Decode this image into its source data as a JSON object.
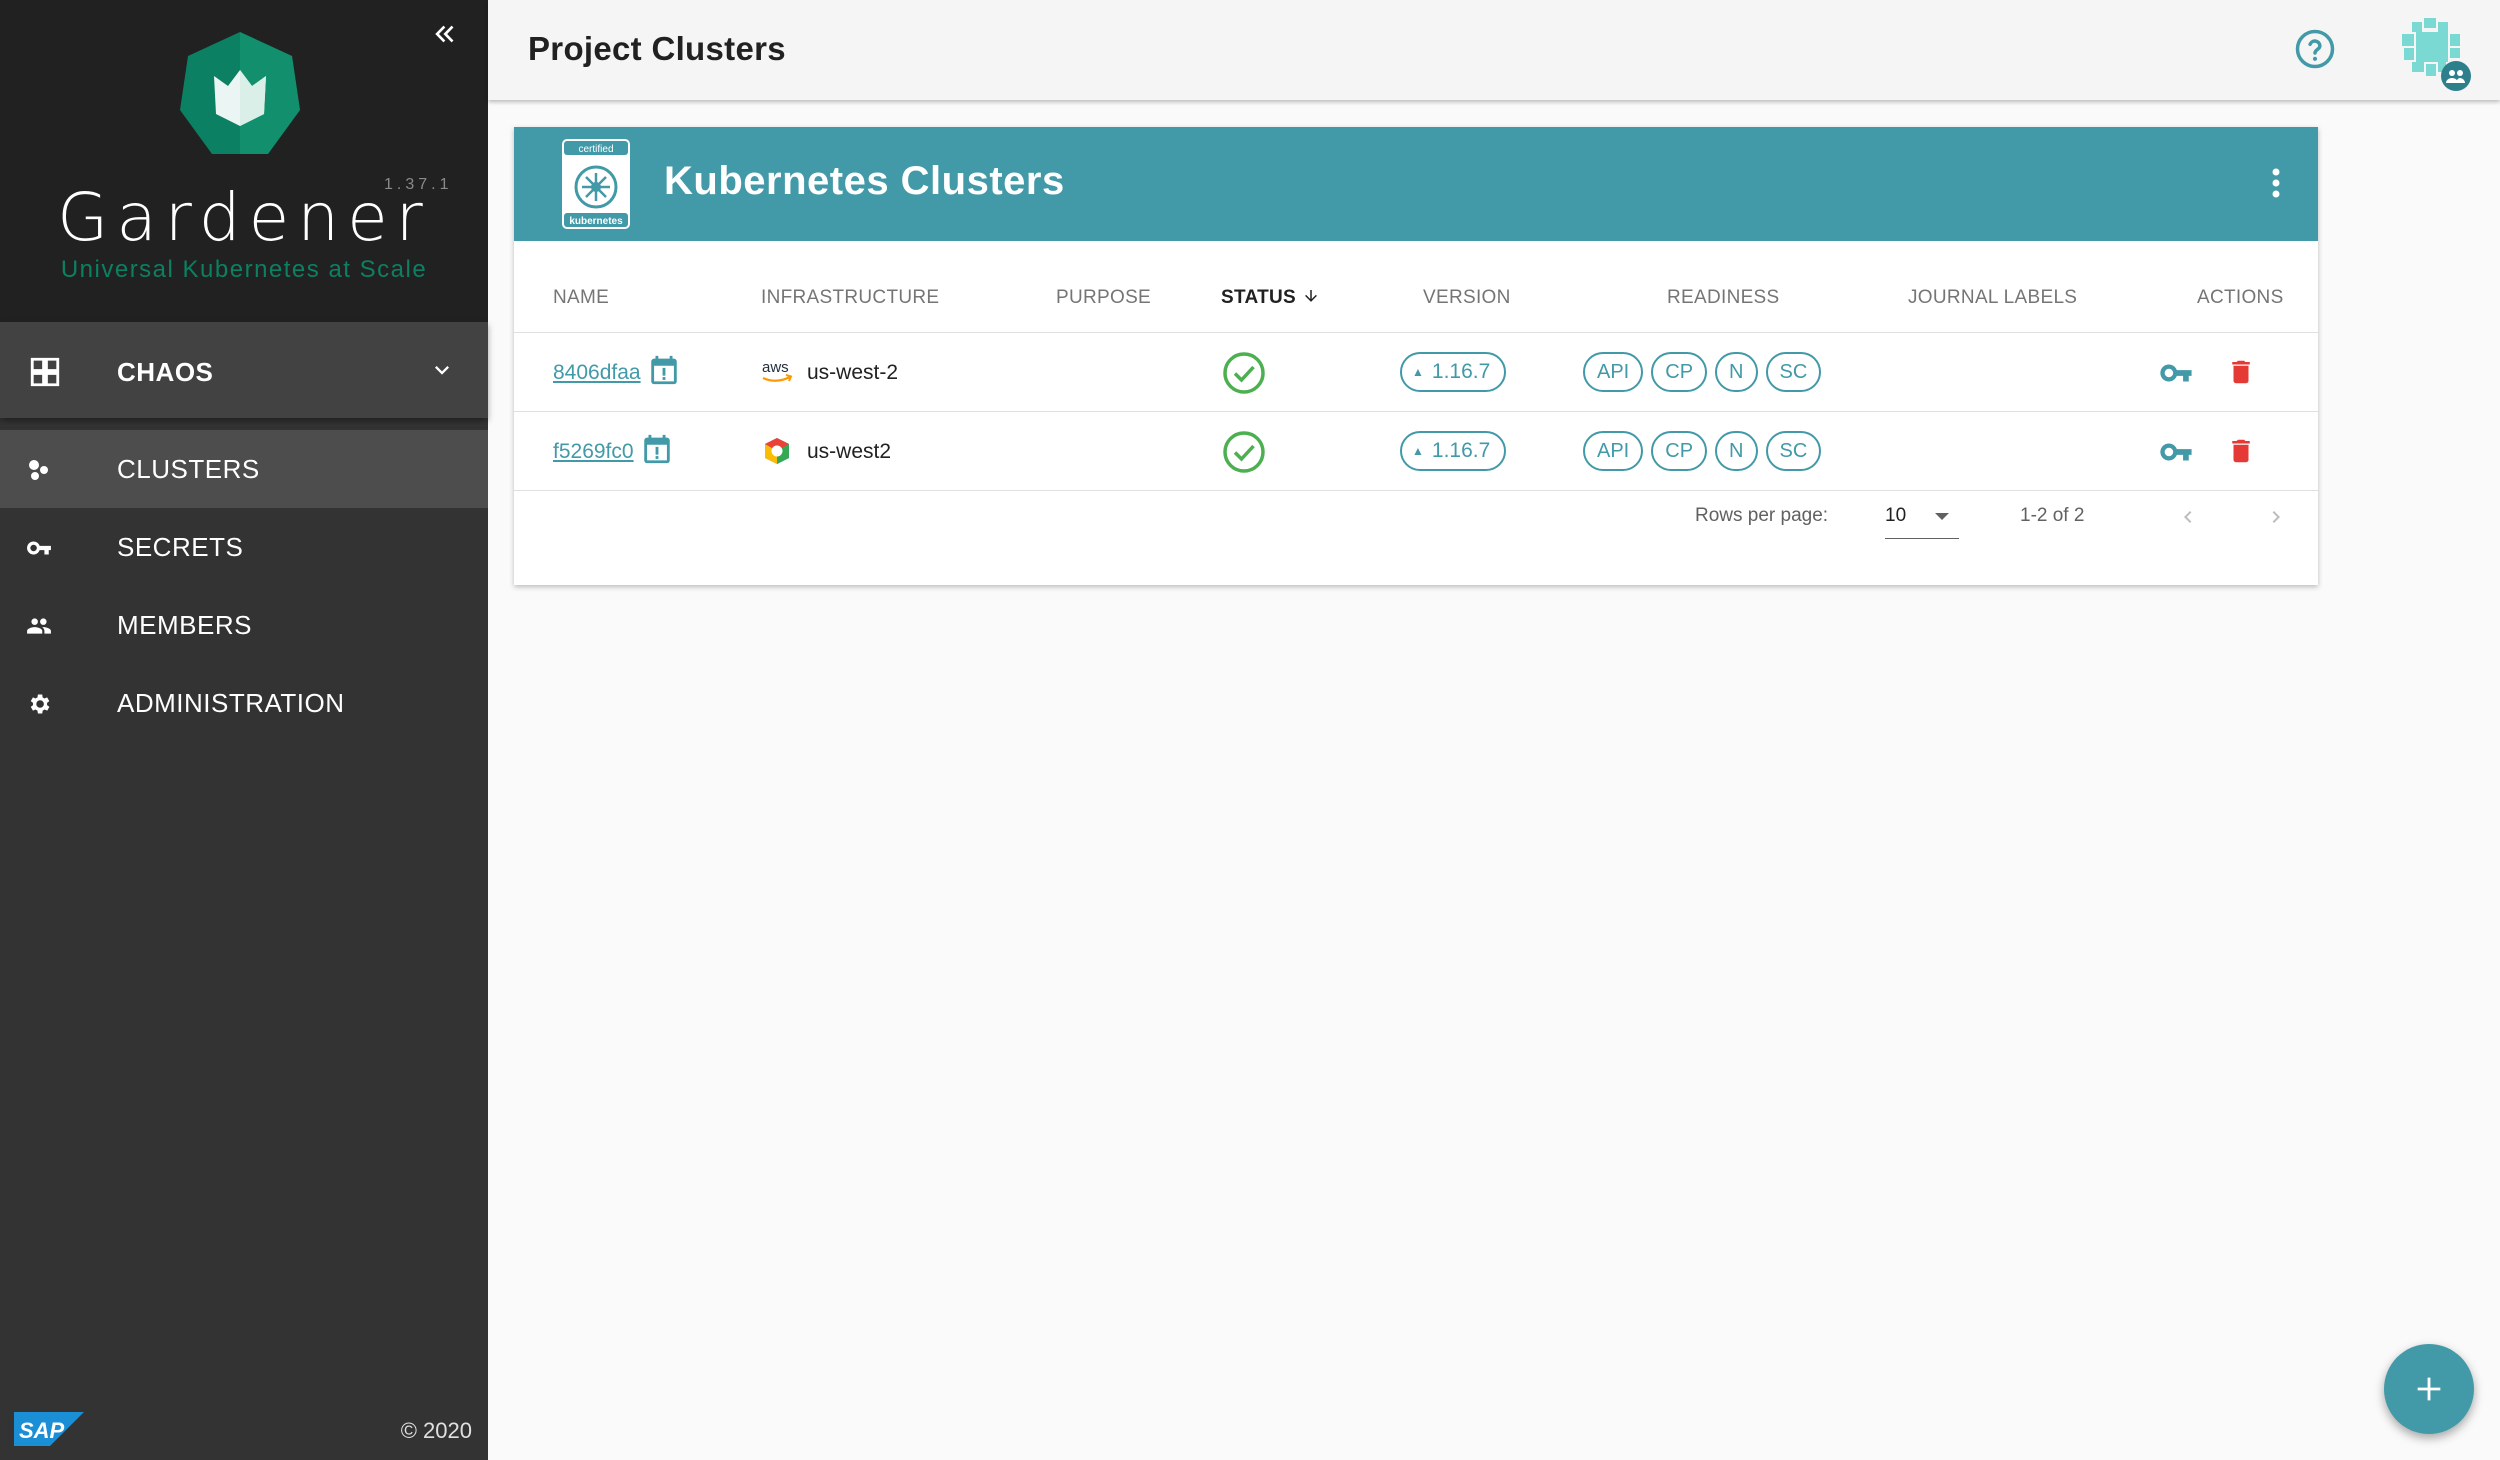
{
  "sidebar": {
    "app_name": "Gardener",
    "version": "1.37.1",
    "tagline": "Universal Kubernetes at Scale",
    "project": "CHAOS",
    "nav": [
      {
        "label": "CLUSTERS",
        "icon": "clusters-icon",
        "active": true
      },
      {
        "label": "SECRETS",
        "icon": "key-icon",
        "active": false
      },
      {
        "label": "MEMBERS",
        "icon": "people-icon",
        "active": false
      },
      {
        "label": "ADMINISTRATION",
        "icon": "gear-icon",
        "active": false
      }
    ],
    "brand": "SAP",
    "copyright": "© 2020"
  },
  "toolbar": {
    "title": "Project Clusters"
  },
  "card": {
    "title": "Kubernetes Clusters",
    "badge_top": "certified",
    "badge_bottom": "kubernetes",
    "columns": {
      "name": "NAME",
      "infrastructure": "INFRASTRUCTURE",
      "purpose": "PURPOSE",
      "status": "STATUS",
      "version": "VERSION",
      "readiness": "READINESS",
      "journal_labels": "JOURNAL LABELS",
      "actions": "ACTIONS"
    },
    "rows": [
      {
        "name": "8406dfaa",
        "provider": "aws",
        "provider_label": "aws",
        "region": "us-west-2",
        "status": "ok",
        "version": "1.16.7",
        "readiness": [
          "API",
          "CP",
          "N",
          "SC"
        ]
      },
      {
        "name": "f5269fc0",
        "provider": "gcp",
        "region": "us-west2",
        "status": "ok",
        "version": "1.16.7",
        "readiness": [
          "API",
          "CP",
          "N",
          "SC"
        ]
      }
    ],
    "pagination": {
      "rows_per_page_label": "Rows per page:",
      "rows_per_page": "10",
      "range": "1-2 of 2"
    }
  },
  "colors": {
    "accent": "#4299a8",
    "success": "#4caf50",
    "danger": "#e53935",
    "sidebar_bg": "#333333",
    "sidebar_header_bg": "#212121",
    "brand_green": "#0b8062"
  }
}
